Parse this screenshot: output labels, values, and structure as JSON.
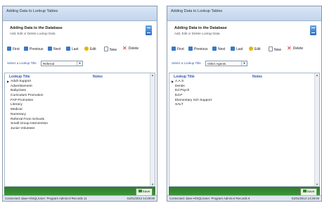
{
  "left": {
    "title": "Adding Data to Lookup Tables",
    "header_title": "Adding Data to the Database",
    "header_sub": "Add, Edit or Delete Lookup Data",
    "toolbar": [
      "First",
      "Previous",
      "Next",
      "Last",
      "Edit",
      "New",
      "Delete"
    ],
    "select_label": "Select a Lookup Title",
    "select_value": "Referral",
    "columns": [
      "Lookup Title",
      "Notes"
    ],
    "rows": [
      "Adult Support",
      "Advertisement",
      "Babyclass",
      "Curriculum Promotion",
      "FAP Promotion",
      "Literacy",
      "Medical",
      "Numeracy",
      "Referral From Schools",
      "Small Group Intervention",
      "Junior Volunteer"
    ],
    "save_label": "Save",
    "status_left": "Connected: dave-H\\SQL\\User: Program Admin:el Records 11",
    "status_right": "01/01/2013 14:29:00"
  },
  "right": {
    "title": "Adding Data to Lookup Tables",
    "header_title": "Adding Data to the Database",
    "header_sub": "Add, Edit or Delete Lookup Data",
    "toolbar": [
      "First",
      "Previous",
      "Next",
      "Last",
      "Edit",
      "New",
      "Delete"
    ],
    "select_label": "Select a Lookup Title",
    "select_value": "Other Agents",
    "columns": [
      "Lookup Title",
      "Notes"
    ],
    "rows": [
      "A.A.S",
      "Dentis",
      "Ed Psych",
      "Ed.P",
      "Elementary Sch Support",
      "SALT"
    ],
    "save_label": "Save",
    "status_left": "Connected: dave-H\\SQL\\User: Program Admin:el Records 6",
    "status_right": "01/01/2013 14:29:00"
  }
}
